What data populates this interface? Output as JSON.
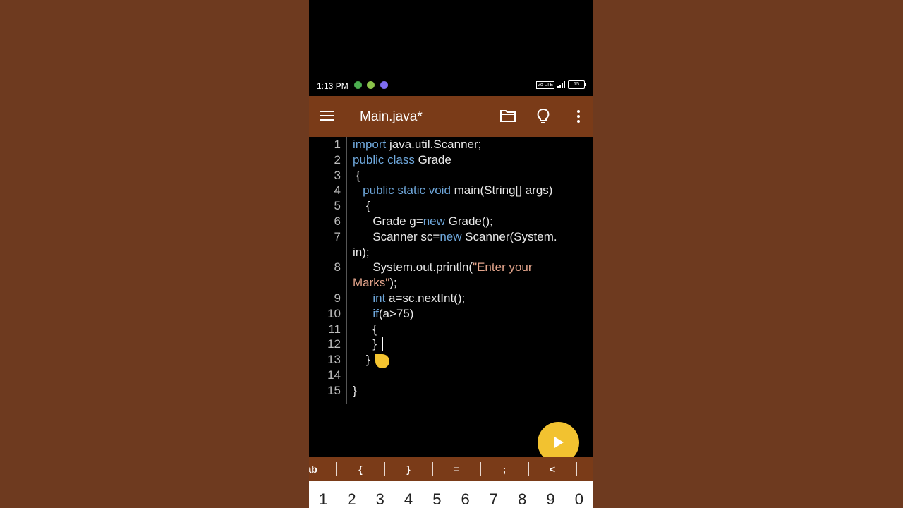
{
  "status_bar": {
    "time": "1:13 PM",
    "battery": "15",
    "vol_label": "Vo LTE"
  },
  "toolbar": {
    "title": "Main.java*"
  },
  "editor": {
    "lines": [
      {
        "n": "1",
        "parts": [
          [
            "kw",
            "import"
          ],
          [
            "t",
            " java.util.Scanner;"
          ]
        ]
      },
      {
        "n": "2",
        "parts": [
          [
            "kw",
            "public class"
          ],
          [
            "t",
            " Grade"
          ]
        ]
      },
      {
        "n": "3",
        "parts": [
          [
            "t",
            " {"
          ]
        ]
      },
      {
        "n": "4",
        "parts": [
          [
            "t",
            "   "
          ],
          [
            "kw",
            "public static void"
          ],
          [
            "t",
            " main(String[] args)"
          ]
        ]
      },
      {
        "n": "5",
        "parts": [
          [
            "t",
            "    {"
          ]
        ]
      },
      {
        "n": "6",
        "parts": [
          [
            "t",
            "      Grade g="
          ],
          [
            "kw",
            "new"
          ],
          [
            "t",
            " Grade();"
          ]
        ]
      },
      {
        "n": "7",
        "parts": [
          [
            "t",
            "      Scanner sc="
          ],
          [
            "kw",
            "new"
          ],
          [
            "t",
            " Scanner(System."
          ]
        ]
      },
      {
        "n": "",
        "parts": [
          [
            "t",
            "in);"
          ]
        ]
      },
      {
        "n": "8",
        "parts": [
          [
            "t",
            "      System.out.println("
          ],
          [
            "str",
            "\"Enter your"
          ]
        ]
      },
      {
        "n": "",
        "parts": [
          [
            "str",
            "Marks\""
          ],
          [
            "t",
            ");"
          ]
        ]
      },
      {
        "n": "9",
        "parts": [
          [
            "t",
            "      "
          ],
          [
            "kw",
            "int"
          ],
          [
            "t",
            " a=sc.nextInt();"
          ]
        ]
      },
      {
        "n": "10",
        "parts": [
          [
            "t",
            "      "
          ],
          [
            "kw",
            "if"
          ],
          [
            "t",
            "(a>75)"
          ]
        ]
      },
      {
        "n": "11",
        "parts": [
          [
            "t",
            "      {"
          ]
        ]
      },
      {
        "n": "12",
        "parts": [
          [
            "t",
            "      }"
          ]
        ]
      },
      {
        "n": "13",
        "parts": [
          [
            "t",
            "    }"
          ]
        ]
      },
      {
        "n": "14",
        "parts": [
          [
            "t",
            ""
          ]
        ]
      },
      {
        "n": "15",
        "parts": [
          [
            "t",
            "}"
          ]
        ]
      }
    ]
  },
  "symbol_bar": [
    "Tab",
    "{",
    "}",
    "=",
    ";",
    "<"
  ],
  "keyboard": [
    "1",
    "2",
    "3",
    "4",
    "5",
    "6",
    "7",
    "8",
    "9",
    "0"
  ],
  "colors": {
    "keyword": "#6fa8dc",
    "string": "#e4a58c",
    "toolbar": "#7a3b18",
    "run_button": "#f2c230"
  }
}
